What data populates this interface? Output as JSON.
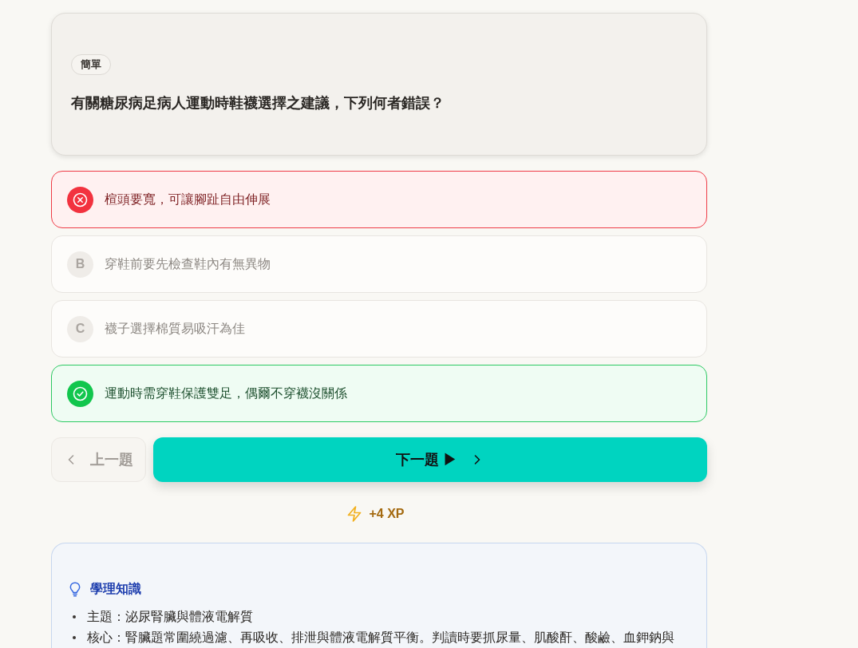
{
  "question": {
    "difficulty": "簡單",
    "text": "有關糖尿病足病人運動時鞋襪選擇之建議，下列何者錯誤？"
  },
  "options": [
    {
      "text": "楦頭要寬，可讓腳趾自由伸展",
      "selected": true,
      "correct": false
    },
    {
      "letter": "B",
      "text": "穿鞋前要先檢查鞋內有無異物",
      "selected": false,
      "correct": false
    },
    {
      "letter": "C",
      "text": "襪子選擇棉質易吸汗為佳",
      "selected": false,
      "correct": false
    },
    {
      "text": "運動時需穿鞋保護雙足，偶爾不穿襪沒關係",
      "selected": false,
      "correct": true
    }
  ],
  "navigation": {
    "previous": {
      "label": "上一題",
      "disabled": true
    },
    "next": {
      "label": "下一題 ▶"
    }
  },
  "reward": "+4 XP",
  "knowledge": {
    "title": "學理知識",
    "items": [
      "主題：泌尿腎臟與體液電解質",
      "核心：腎臟題常圍繞過濾、再吸收、排泄與體液電解質平衡。判讀時要抓尿量、肌酸酐、酸鹼、血鉀鈉與"
    ]
  }
}
